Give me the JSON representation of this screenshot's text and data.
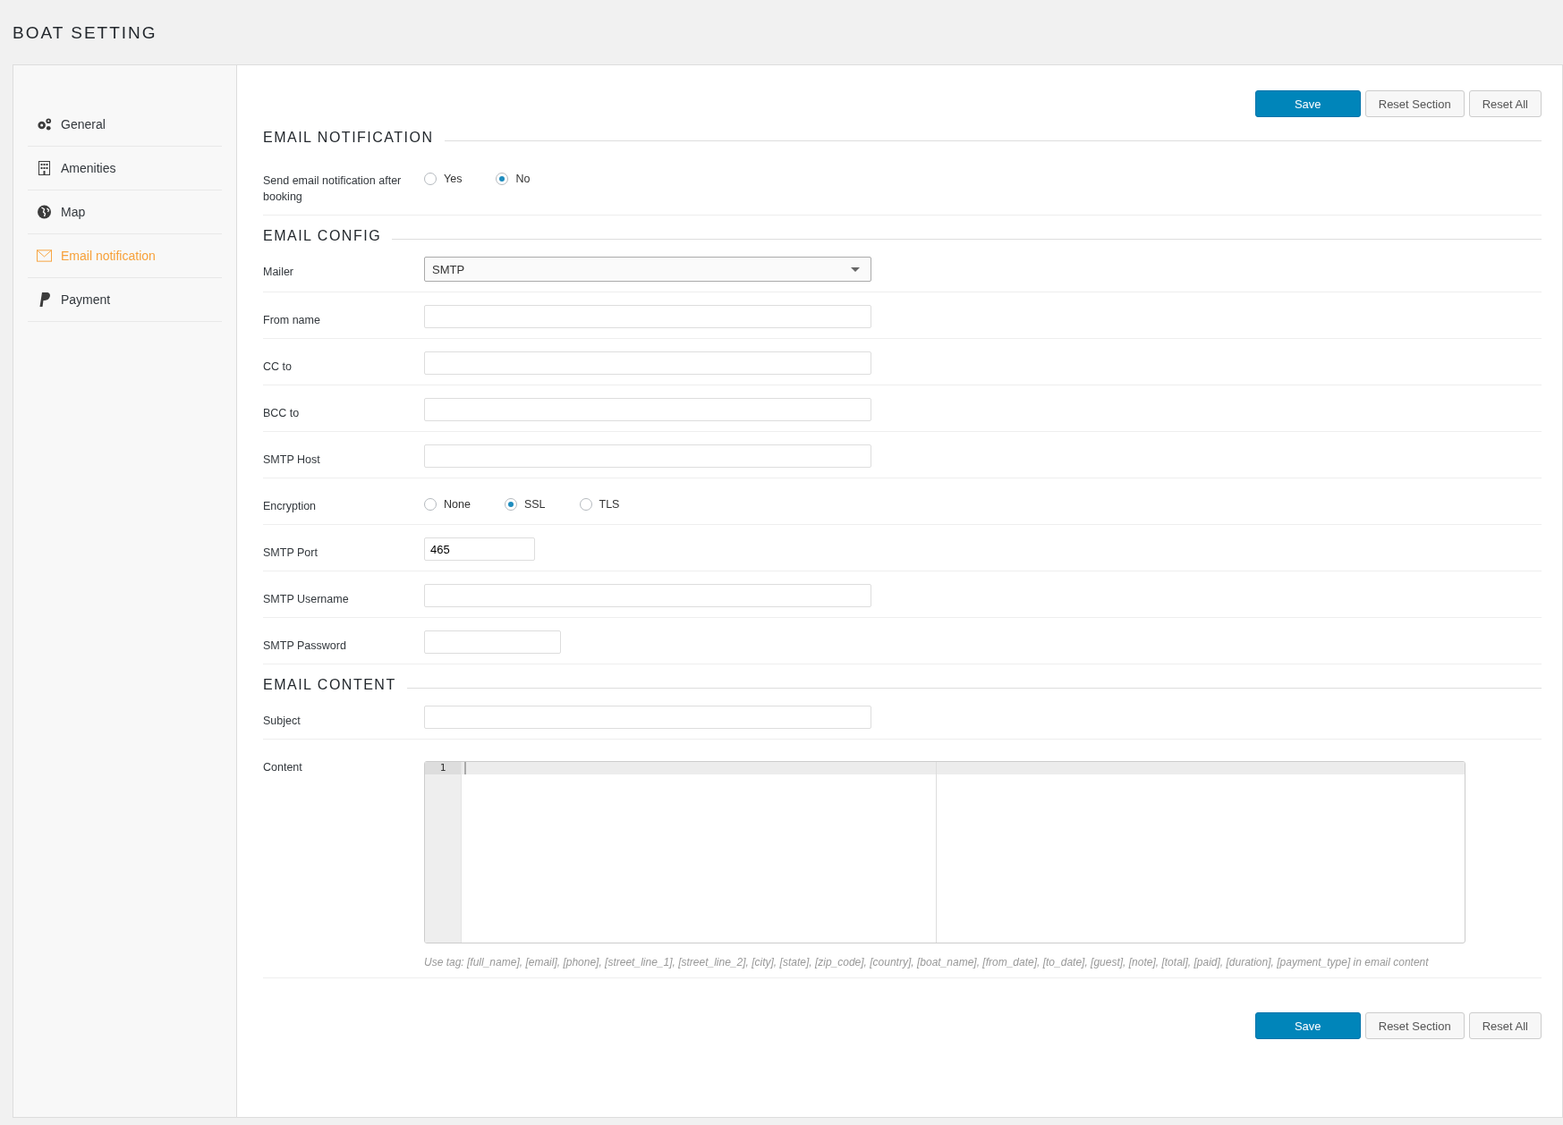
{
  "page_title": "BOAT SETTING",
  "sidebar": {
    "items": [
      {
        "label": "General",
        "selected": false
      },
      {
        "label": "Amenities",
        "selected": false
      },
      {
        "label": "Map",
        "selected": false
      },
      {
        "label": "Email notification",
        "selected": true
      },
      {
        "label": "Payment",
        "selected": false
      }
    ]
  },
  "top_buttons": [
    {
      "label": "Save",
      "kind": "primary"
    },
    {
      "label": "Reset Section",
      "kind": "secondary"
    },
    {
      "label": "Reset All",
      "kind": "secondary"
    }
  ],
  "sections": [
    {
      "title": "EMAIL NOTIFICATION",
      "rows": [
        {
          "label": "Send email notification after booking",
          "kind": "radio",
          "options": [
            {
              "label": "Yes",
              "selected": false
            },
            {
              "label": "No",
              "selected": true
            }
          ]
        }
      ]
    },
    {
      "title": "EMAIL CONFIG",
      "rows": [
        {
          "label": "Mailer",
          "kind": "select",
          "value": "SMTP"
        },
        {
          "label": "From name",
          "kind": "text"
        },
        {
          "label": "CC to",
          "kind": "text"
        },
        {
          "label": "BCC to",
          "kind": "text"
        },
        {
          "label": "SMTP Host",
          "kind": "text"
        },
        {
          "label": "Encryption",
          "kind": "radio",
          "options": [
            {
              "label": "None",
              "selected": false
            },
            {
              "label": "SSL",
              "selected": true
            },
            {
              "label": "TLS",
              "selected": false
            }
          ]
        },
        {
          "label": "SMTP Port",
          "kind": "number",
          "value": "465"
        },
        {
          "label": "SMTP Username",
          "kind": "text"
        },
        {
          "label": "SMTP Password",
          "kind": "password"
        }
      ]
    },
    {
      "title": "EMAIL CONTENT",
      "rows": [
        {
          "label": "Subject",
          "kind": "text"
        },
        {
          "label": "Content",
          "kind": "editor",
          "line_number": "1",
          "hint": "Use tag: [full_name], [email], [phone], [street_line_1], [street_line_2], [city], [state], [zip_code], [country], [boat_name], [from_date], [to_date], [guest], [note], [total], [paid], [duration], [payment_type] in email content"
        }
      ]
    }
  ],
  "bottom_buttons": [
    {
      "label": "Save",
      "kind": "primary"
    },
    {
      "label": "Reset Section",
      "kind": "secondary"
    },
    {
      "label": "Reset All",
      "kind": "secondary"
    }
  ]
}
